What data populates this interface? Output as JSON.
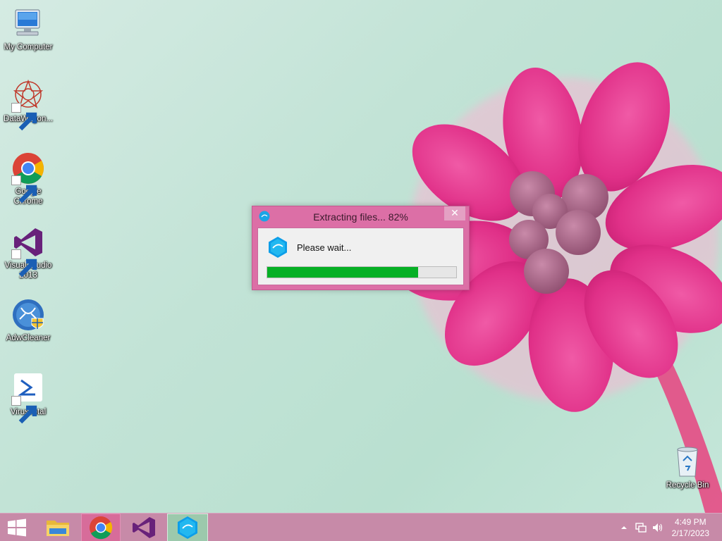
{
  "desktop": {
    "icons": [
      {
        "label": "My Computer",
        "icon": "computer-icon"
      },
      {
        "label": "DataWagon...",
        "icon": "datawagon-icon"
      },
      {
        "label": "Google\nChrome",
        "icon": "chrome-icon"
      },
      {
        "label": "Visual Studio\n2013",
        "icon": "visual-studio-icon"
      },
      {
        "label": "AdwCleaner",
        "icon": "adwcleaner-icon"
      },
      {
        "label": "VirusTotal",
        "icon": "virustotal-icon"
      },
      {
        "label": "Recycle Bin",
        "icon": "recycle-bin-icon"
      }
    ]
  },
  "dialog": {
    "title": "Extracting files... 82%",
    "close_label": "✕",
    "message": "Please wait...",
    "progress": 0.8,
    "colors": {
      "frame": "#dc6fa6",
      "progress": "#06b025"
    }
  },
  "taskbar": {
    "apps": [
      {
        "name": "File Explorer",
        "icon": "file-explorer-icon"
      },
      {
        "name": "Google Chrome",
        "icon": "chrome-icon"
      },
      {
        "name": "Visual Studio",
        "icon": "visual-studio-icon"
      },
      {
        "name": "Renee extractor",
        "icon": "renee-icon"
      }
    ],
    "clock": {
      "time": "4:49 PM",
      "date": "2/17/2023"
    },
    "tray_icons": [
      "chevron-up-icon",
      "network-icon",
      "volume-icon"
    ]
  }
}
